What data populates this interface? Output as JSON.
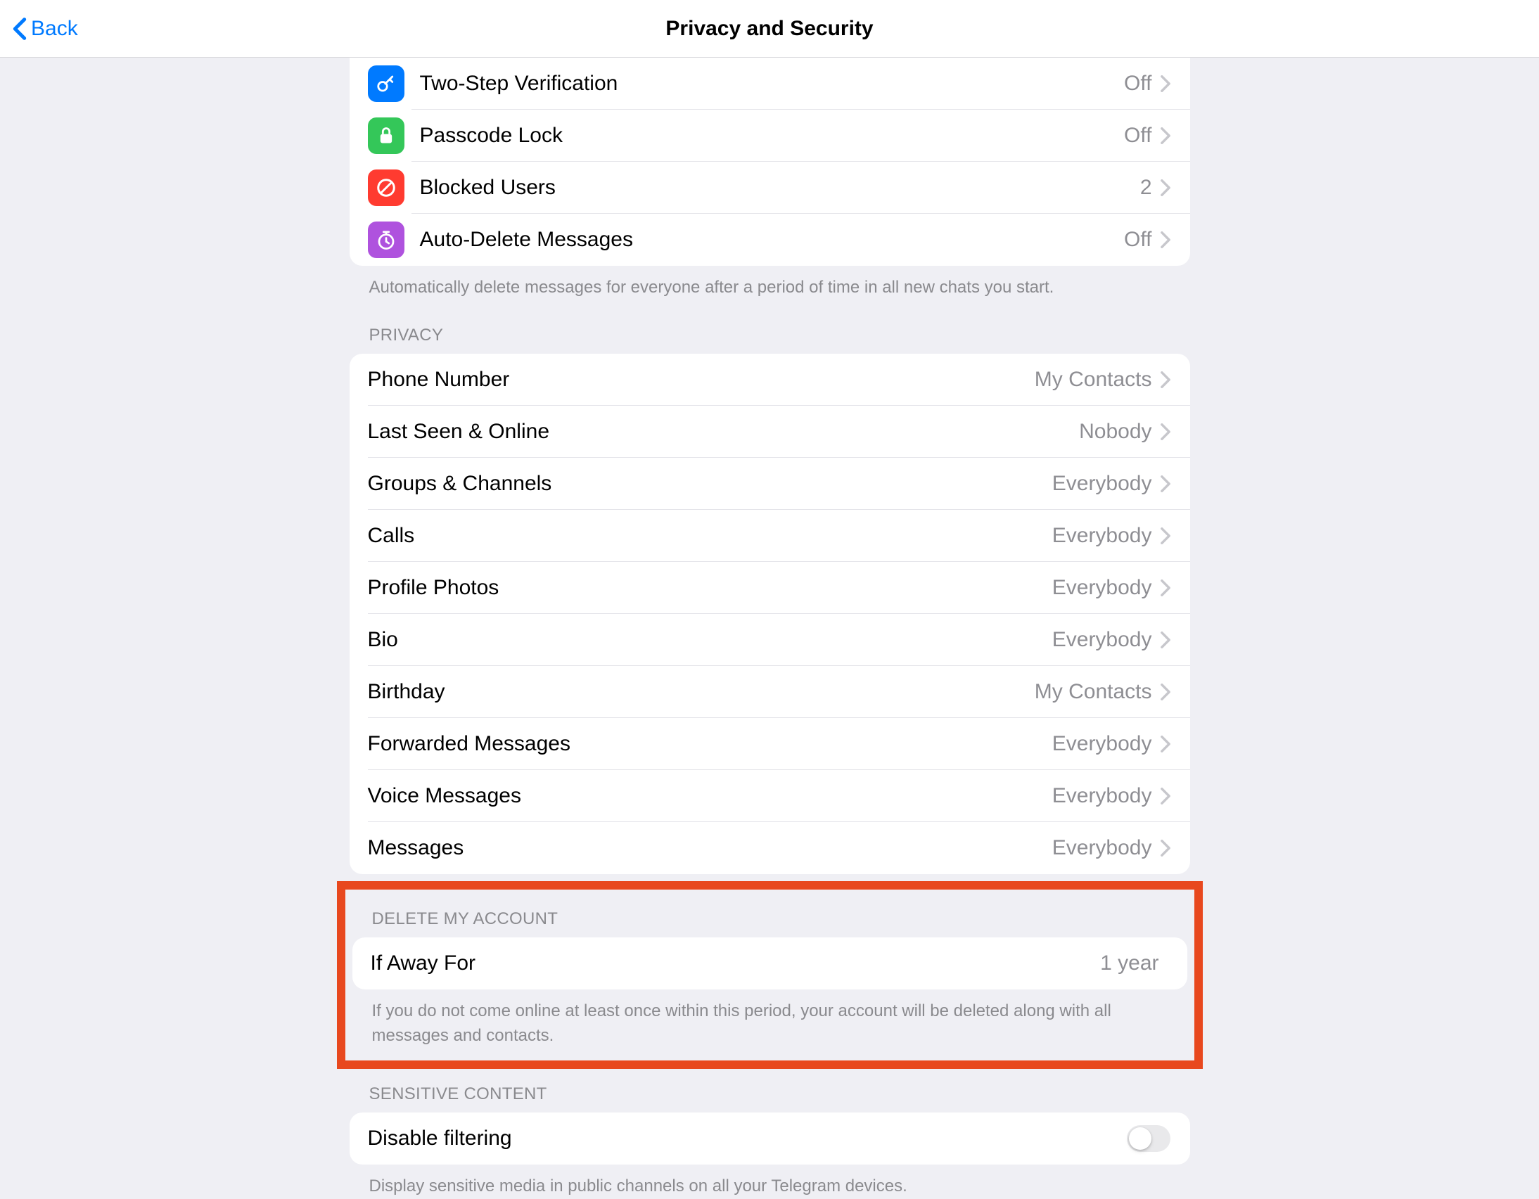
{
  "header": {
    "back_label": "Back",
    "title": "Privacy and Security"
  },
  "security": {
    "items": [
      {
        "label": "Two-Step Verification",
        "value": "Off"
      },
      {
        "label": "Passcode Lock",
        "value": "Off"
      },
      {
        "label": "Blocked Users",
        "value": "2"
      },
      {
        "label": "Auto-Delete Messages",
        "value": "Off"
      }
    ],
    "footer": "Automatically delete messages for everyone after a period of time in all new chats you start."
  },
  "privacy": {
    "header": "PRIVACY",
    "items": [
      {
        "label": "Phone Number",
        "value": "My Contacts"
      },
      {
        "label": "Last Seen & Online",
        "value": "Nobody"
      },
      {
        "label": "Groups & Channels",
        "value": "Everybody"
      },
      {
        "label": "Calls",
        "value": "Everybody"
      },
      {
        "label": "Profile Photos",
        "value": "Everybody"
      },
      {
        "label": "Bio",
        "value": "Everybody"
      },
      {
        "label": "Birthday",
        "value": "My Contacts"
      },
      {
        "label": "Forwarded Messages",
        "value": "Everybody"
      },
      {
        "label": "Voice Messages",
        "value": "Everybody"
      },
      {
        "label": "Messages",
        "value": "Everybody"
      }
    ]
  },
  "delete_account": {
    "header": "DELETE MY ACCOUNT",
    "row_label": "If Away For",
    "row_value": "1 year",
    "footer": "If you do not come online at least once within this period, your account will be deleted along with all messages and contacts."
  },
  "sensitive": {
    "header": "SENSITIVE CONTENT",
    "row_label": "Disable filtering",
    "footer": "Display sensitive media in public channels on all your Telegram devices."
  }
}
